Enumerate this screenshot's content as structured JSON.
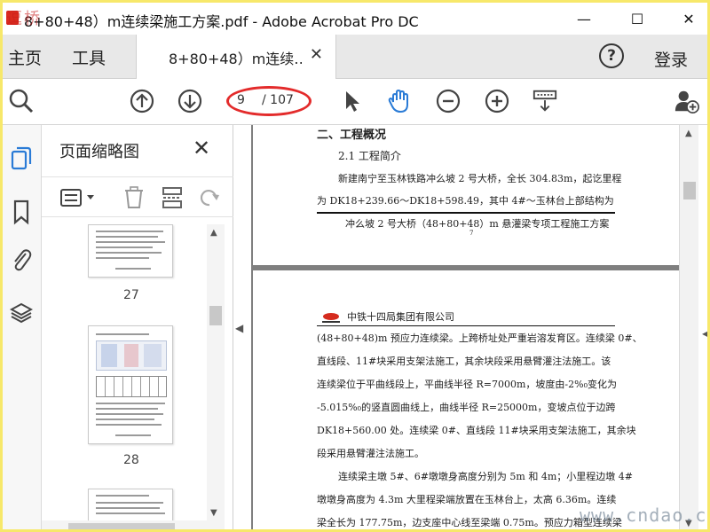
{
  "titlebar": {
    "overlay_text": "逗桥",
    "title": "8+80+48）m连续梁施工方案.pdf - Adobe Acrobat Pro DC",
    "minimize": "—",
    "maximize": "☐",
    "close": "✕"
  },
  "tabs": {
    "home": "主页",
    "tools": "工具",
    "document": "8+80+48）m连续…",
    "close": "✕"
  },
  "header_right": {
    "help": "?",
    "login": "登录"
  },
  "toolbar": {
    "current_page": "9",
    "total_pages": "/ 107",
    "icons": [
      "search-zoom-icon",
      "page-up-icon",
      "page-down-icon",
      "select-cursor-icon",
      "hand-tool-icon",
      "zoom-out-icon",
      "zoom-in-icon",
      "keyboard-scroll-icon",
      "add-user-icon"
    ]
  },
  "rail": {
    "icons": [
      "page-thumbnails-icon",
      "bookmark-icon",
      "attachment-icon",
      "layers-icon"
    ]
  },
  "thumbnail_panel": {
    "title": "页面缩略图",
    "close": "✕",
    "pages": [
      {
        "label": "27"
      },
      {
        "label": "28"
      }
    ]
  },
  "document": {
    "page1": {
      "section_heading": "二、工程概况",
      "subheading": "2.1 工程简介",
      "para_line1": "新建南宁至玉林铁路冲么坡 2 号大桥，全长 304.83m，起讫里程",
      "para_line2": "为 DK18+239.66～DK18+598.49，其中 4#～玉林台上部结构为",
      "footer": "冲么坡 2 号大桥（48+80+48）m 悬灌梁专项工程施工方案",
      "page_number": "7"
    },
    "page2": {
      "company": "中铁十四局集团有限公司",
      "lines": [
        "(48+80+48)m 预应力连续梁。上跨桥址处严重岩溶发育区。连续梁 0#、",
        "直线段、11#块采用支架法施工，其余块段采用悬臂灌注法施工。该",
        "连续梁位于平曲线段上，平曲线半径 R=7000m，坡度由-2%₀变化为",
        "-5.015%₀的竖直圆曲线上，曲线半径 R=25000m，变坡点位于边跨",
        "DK18+560.00 处。连续梁 0#、直线段 11#块采用支架法施工，其余块",
        "段采用悬臂灌注法施工。",
        "连续梁主墩 5#、6#墩墩身高度分别为 5m 和 4m；小里程边墩 4#",
        "墩墩身高度为 4.3m 大里程梁端放置在玉林台上，太高 6.36m。连续",
        "梁全长为 177.75m，边支座中心线至梁端 0.75m。预应力箱型连续梁"
      ]
    }
  },
  "watermark": "www.cndao.com",
  "colors": {
    "annotation_red": "#e32b2b",
    "hand_tool_blue": "#2a7bd6",
    "frame_yellow": "#f7e86a"
  }
}
